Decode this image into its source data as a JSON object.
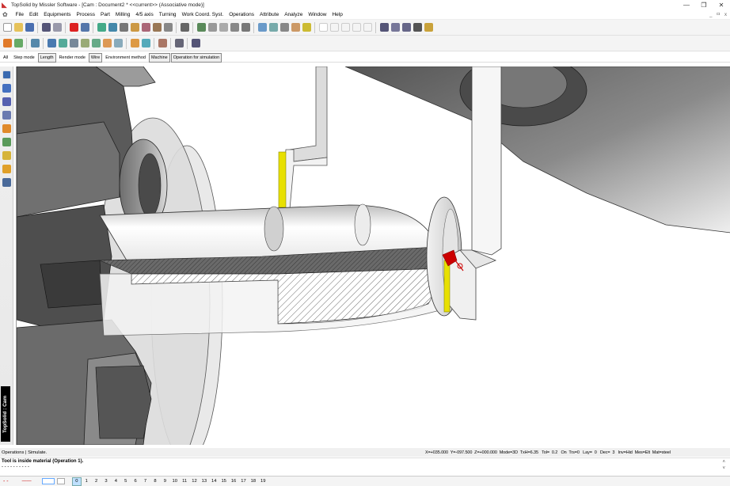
{
  "window": {
    "title": "TopSolid by Missler Software - [Cam : Document2 * <<current>> (Associative mode)]",
    "controls": [
      "—",
      "❐",
      "✕"
    ],
    "mdi": [
      "_",
      "ㅁ",
      "x"
    ]
  },
  "menu": [
    "File",
    "Edit",
    "Equipments",
    "Process",
    "Part",
    "Milling",
    "4/5 axis",
    "Turning",
    "Work Coord. Syst.",
    "Operations",
    "Attribute",
    "Analyze",
    "Window",
    "Help"
  ],
  "modes": [
    "All",
    "Step mode",
    "Length",
    "Render mode",
    "Wire",
    "Environment method",
    "Machine",
    "Operation for simulation"
  ],
  "side_label": "TopSolid : Cam",
  "status": {
    "left": "Operations | Simulate.",
    "coords": "X=+035.000  Y=-097.500  Z=+000.000  Mode=3D  TxH=6.35   Tol=  0.2   On  Trs=0   Lay=  0   Dec=  3   Inv=Hid  Mes=Elt  Mat=steel"
  },
  "messages": [
    "Tool is inside material (Operation 1).",
    "- - - - - - - - - -"
  ],
  "layers": [
    "0",
    "1",
    "2",
    "3",
    "4",
    "5",
    "6",
    "7",
    "8",
    "9",
    "10",
    "11",
    "12",
    "13",
    "14",
    "15",
    "16",
    "17",
    "18",
    "19"
  ],
  "colors": {
    "accent": "#e8e000",
    "cutter_red": "#cc0000"
  }
}
